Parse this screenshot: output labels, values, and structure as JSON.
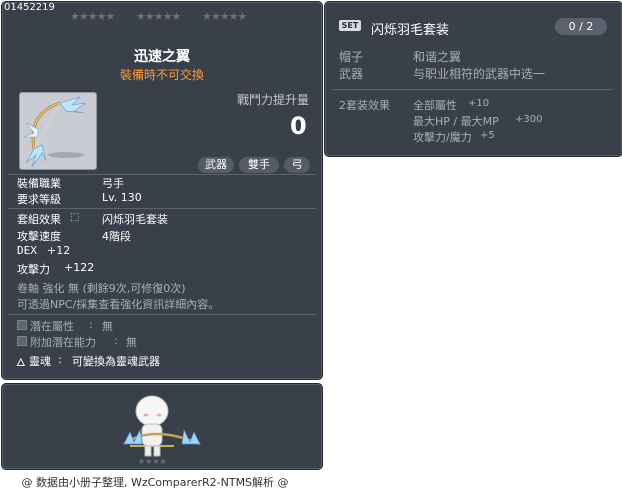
{
  "item": {
    "id": "01452219",
    "name": "迅速之翼",
    "untradeable": "裝備時不可交換",
    "power_label": "戰鬥力提升量",
    "power_value": "0",
    "tags": [
      "武器",
      "雙手",
      "弓"
    ],
    "job_label": "裝備職業",
    "job_value": "弓手",
    "level_label": "要求等級",
    "level_value": "Lv. 130",
    "set_label": "套組效果",
    "set_value": "闪烁羽毛套装",
    "speed_label": "攻擊速度",
    "speed_value": "4階段",
    "dex_label": "DEX",
    "dex_value": "+12",
    "atk_label": "攻擊力",
    "atk_value": "+122",
    "scroll_text": "卷軸 強化 無 (剩餘9次,可修復0次)",
    "npc_text": "可透過NPC/採集查看強化資訊詳細內容。",
    "potential_label": "潛在屬性",
    "potential_value": "無",
    "bonus_potential_label": "附加潛在能力",
    "bonus_potential_value": "無",
    "soul_label": "靈魂",
    "soul_value": "可變換為靈魂武器"
  },
  "set": {
    "badge": "SET",
    "name": "闪烁羽毛套装",
    "count": "0 / 2",
    "items": [
      {
        "name": "帽子",
        "value": "和谐之翼"
      },
      {
        "name": "武器",
        "value": "与职业相符的武器中选一"
      }
    ],
    "effect_label": "2套装效果",
    "effects": [
      {
        "name": "全部屬性",
        "value": "+10"
      },
      {
        "name": "最大HP / 最大MP",
        "value": "+300"
      },
      {
        "name": "攻擊力/魔力",
        "value": "+5"
      }
    ]
  },
  "footer": "@ 数据由小册子整理, WzComparerR2-NTMS解析 @"
}
